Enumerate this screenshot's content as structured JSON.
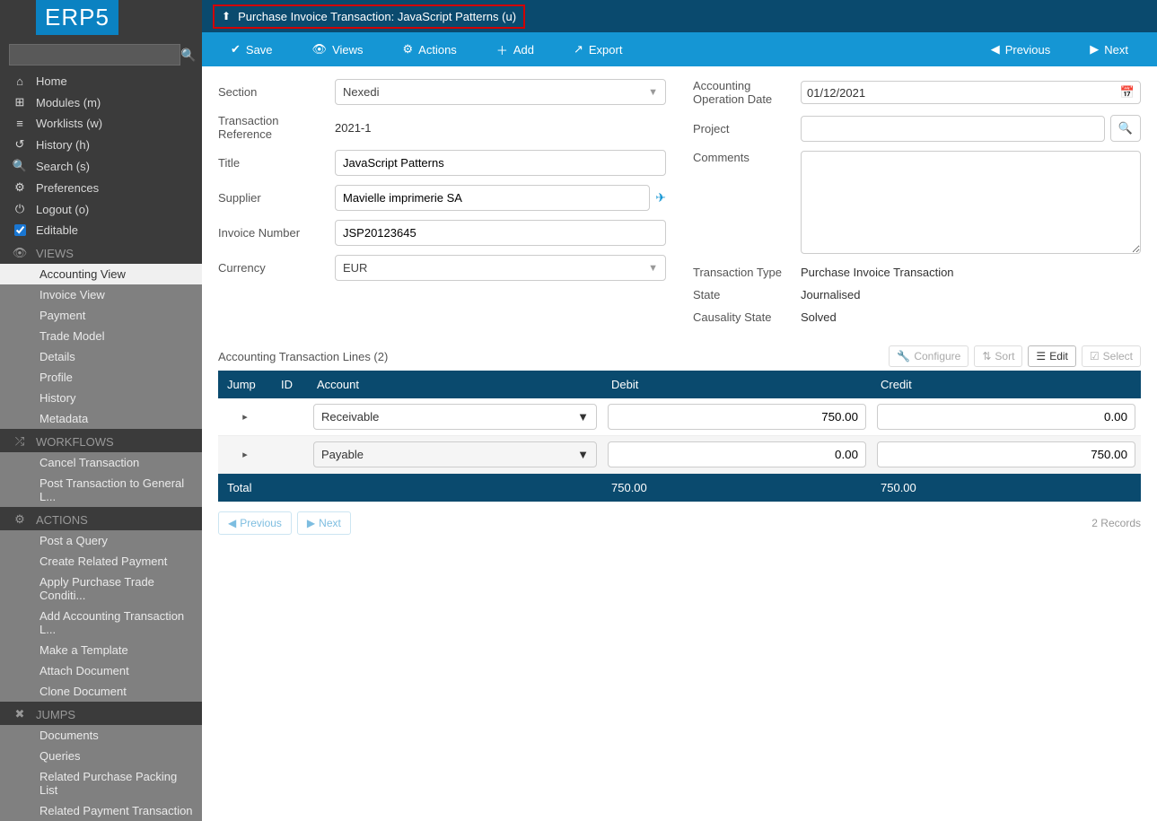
{
  "logo": "ERP5",
  "sidebar": {
    "main": [
      {
        "icon": "⌂",
        "label": "Home"
      },
      {
        "icon": "⊞",
        "label": "Modules (m)"
      },
      {
        "icon": "≡",
        "label": "Worklists (w)"
      },
      {
        "icon": "↺",
        "label": "History (h)"
      },
      {
        "icon": "🔍",
        "label": "Search (s)"
      },
      {
        "icon": "⚙",
        "label": "Preferences"
      },
      {
        "icon": "⏻",
        "label": "Logout (o)"
      }
    ],
    "editable_label": "Editable",
    "sections": {
      "views": {
        "icon": "👁",
        "title": "VIEWS",
        "items": [
          "Accounting View",
          "Invoice View",
          "Payment",
          "Trade Model",
          "Details",
          "Profile",
          "History",
          "Metadata"
        ],
        "active": "Accounting View"
      },
      "workflows": {
        "icon": "⤮",
        "title": "WORKFLOWS",
        "items": [
          "Cancel Transaction",
          "Post Transaction to General L..."
        ]
      },
      "actions": {
        "icon": "⚙",
        "title": "ACTIONS",
        "items": [
          "Post a Query",
          "Create Related Payment",
          "Apply Purchase Trade Conditi...",
          "Add Accounting Transaction L...",
          "Make a Template",
          "Attach Document",
          "Clone Document"
        ]
      },
      "jumps": {
        "icon": "✖",
        "title": "JUMPS",
        "items": [
          "Documents",
          "Queries",
          "Related Purchase Packing List",
          "Related Payment Transaction"
        ]
      }
    }
  },
  "titlebar": {
    "icon": "⬆",
    "text": "Purchase Invoice Transaction: JavaScript Patterns (u)"
  },
  "toolbar": [
    {
      "icon": "✔",
      "label": "Save"
    },
    {
      "icon": "👁",
      "label": "Views"
    },
    {
      "icon": "⚙",
      "label": "Actions"
    },
    {
      "icon": "＋",
      "label": "Add"
    },
    {
      "icon": "↗",
      "label": "Export"
    },
    {
      "icon": "◀",
      "label": "Previous"
    },
    {
      "icon": "▶",
      "label": "Next"
    }
  ],
  "left_form": {
    "section_label": "Section",
    "section_value": "Nexedi",
    "txref_label": "Transaction Reference",
    "txref_value": "2021-1",
    "title_label": "Title",
    "title_value": "JavaScript Patterns",
    "supplier_label": "Supplier",
    "supplier_value": "Mavielle imprimerie SA",
    "invoice_label": "Invoice Number",
    "invoice_value": "JSP20123645",
    "currency_label": "Currency",
    "currency_value": "EUR"
  },
  "right_form": {
    "opdate_label": "Accounting Operation Date",
    "opdate_value": "01/12/2021",
    "project_label": "Project",
    "project_value": "",
    "comments_label": "Comments",
    "comments_value": "",
    "txtype_label": "Transaction Type",
    "txtype_value": "Purchase Invoice Transaction",
    "state_label": "State",
    "state_value": "Journalised",
    "causality_label": "Causality State",
    "causality_value": "Solved"
  },
  "listbox": {
    "title": "Accounting Transaction Lines (2)",
    "tools": {
      "configure": "Configure",
      "sort": "Sort",
      "edit": "Edit",
      "select": "Select"
    },
    "cols": {
      "jump": "Jump",
      "id": "ID",
      "account": "Account",
      "debit": "Debit",
      "credit": "Credit"
    },
    "rows": [
      {
        "account": "Receivable",
        "debit": "750.00",
        "credit": "0.00"
      },
      {
        "account": "Payable",
        "debit": "0.00",
        "credit": "750.00"
      }
    ],
    "total": {
      "label": "Total",
      "debit": "750.00",
      "credit": "750.00"
    },
    "pager": {
      "prev": "Previous",
      "next": "Next",
      "records": "2 Records"
    }
  }
}
